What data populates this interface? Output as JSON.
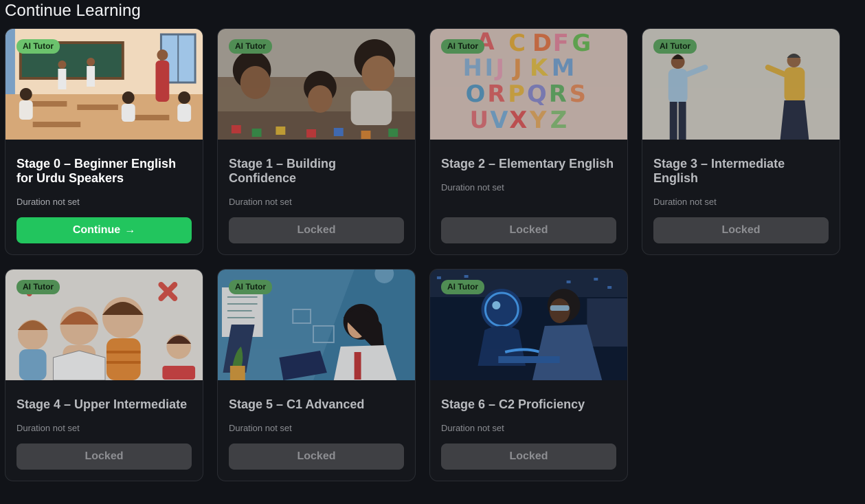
{
  "page": {
    "title": "Continue Learning"
  },
  "colors": {
    "background": "#111318",
    "card": "#15171c",
    "badge": "#6cc36d",
    "continue_button": "#22c55e",
    "locked_button": "#3f4044"
  },
  "cards": [
    {
      "badge": "AI Tutor",
      "title": "Stage 0 – Beginner English for Urdu Speakers",
      "duration": "Duration not set",
      "button": "Continue",
      "button_icon": "arrow-right-icon",
      "locked": false,
      "image": "classroom-illustration"
    },
    {
      "badge": "AI Tutor",
      "title": "Stage 1 – Building Confidence",
      "duration": "Duration not set",
      "button": "Locked",
      "locked": true,
      "image": "children-playing-blocks"
    },
    {
      "badge": "AI Tutor",
      "title": "Stage 2 – Elementary English",
      "duration": "Duration not set",
      "button": "Locked",
      "locked": true,
      "image": "alphabet-letters"
    },
    {
      "badge": "AI Tutor",
      "title": "Stage 3 – Intermediate English",
      "duration": "Duration not set",
      "button": "Locked",
      "locked": true,
      "image": "two-people-conversation"
    },
    {
      "badge": "AI Tutor",
      "title": "Stage 4 – Upper Intermediate",
      "duration": "Duration not set",
      "button": "Locked",
      "locked": true,
      "image": "kids-reading-cartoon"
    },
    {
      "badge": "AI Tutor",
      "title": "Stage 5 – C1 Advanced",
      "duration": "Duration not set",
      "button": "Locked",
      "locked": true,
      "image": "woman-at-laptop"
    },
    {
      "badge": "AI Tutor",
      "title": "Stage 6 – C2 Proficiency",
      "duration": "Duration not set",
      "button": "Locked",
      "locked": true,
      "image": "robot-and-student"
    }
  ]
}
